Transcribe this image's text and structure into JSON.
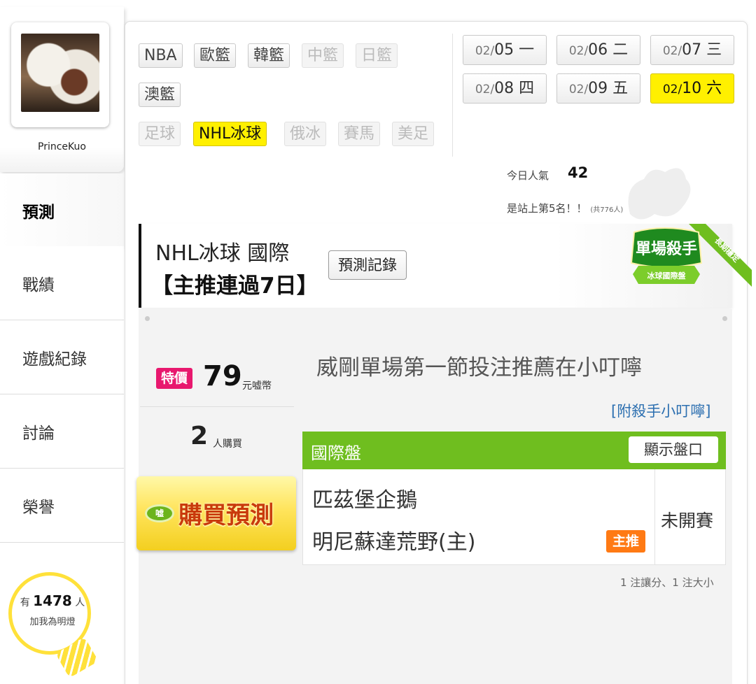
{
  "profile": {
    "username": "PrinceKuo"
  },
  "nav": {
    "items": [
      {
        "label": "預測",
        "active": true
      },
      {
        "label": "戰績",
        "active": false
      },
      {
        "label": "遊戲紀錄",
        "active": false
      },
      {
        "label": "討論",
        "active": false
      },
      {
        "label": "榮譽",
        "active": false
      }
    ]
  },
  "fans": {
    "prefix": "有",
    "count": "1478",
    "suffix": "人",
    "caption": "加我為明燈"
  },
  "sports": {
    "row1": [
      {
        "label": "NBA",
        "state": "normal"
      },
      {
        "label": "歐籃",
        "state": "normal"
      },
      {
        "label": "韓籃",
        "state": "normal"
      },
      {
        "label": "中籃",
        "state": "disabled"
      },
      {
        "label": "日籃",
        "state": "disabled"
      }
    ],
    "row2": [
      {
        "label": "澳籃",
        "state": "normal"
      }
    ],
    "row3": [
      {
        "label": "足球",
        "state": "disabled"
      },
      {
        "label": "NHL冰球",
        "state": "active"
      },
      {
        "label": "俄冰",
        "state": "disabled"
      },
      {
        "label": "賽馬",
        "state": "disabled"
      },
      {
        "label": "美足",
        "state": "disabled"
      }
    ]
  },
  "dates": [
    {
      "md": "02/",
      "day": "05 一",
      "active": false
    },
    {
      "md": "02/",
      "day": "06 二",
      "active": false
    },
    {
      "md": "02/",
      "day": "07 三",
      "active": false
    },
    {
      "md": "02/",
      "day": "08 四",
      "active": false
    },
    {
      "md": "02/",
      "day": "09 五",
      "active": false
    },
    {
      "md": "02/",
      "day": "10 六",
      "active": true
    }
  ],
  "popularity": {
    "label": "今日人氣",
    "value": "42",
    "rank_text": "是站上第5名！！",
    "rank_total": "(共776人)"
  },
  "prediction": {
    "title": "NHL冰球 國際",
    "streak": "【主推連過7日】",
    "record_button": "預測記錄",
    "badge_title": "單場殺手",
    "badge_sub": "冰球國際盤",
    "badge_ribbon": "長期穩定",
    "sale_label": "特價",
    "price": "79",
    "price_unit": "元嘘幣",
    "buyers": "2",
    "buyers_unit": "人購買",
    "buy_label": "購買預測",
    "buy_icon_text": "嘘",
    "rec_title": "威剛單場第一節投注推薦在小叮嚀",
    "rec_link": "[附殺手小叮嚀]",
    "odds_header": "國際盤",
    "show_odds": "顯示盤口",
    "team_away": "匹茲堡企鵝",
    "team_home": "明尼蘇達荒野(主)",
    "main_pick": "主推",
    "status": "未開賽",
    "bets_summary": "1 注讓分、1 注大小"
  },
  "colors": {
    "active_yellow": "#fff000",
    "header_green": "#6fbe1f",
    "sale_pink": "#e8186e",
    "pick_orange": "#ff7a14",
    "link_blue": "#2c6fb0"
  }
}
